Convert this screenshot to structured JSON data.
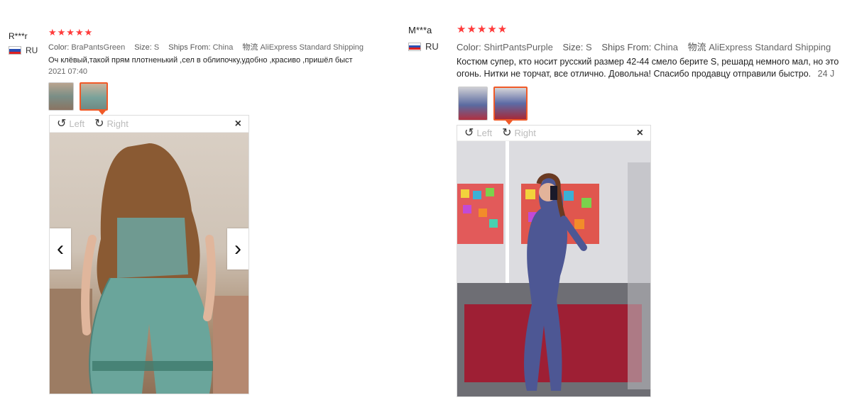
{
  "reviews": [
    {
      "user": "R***r",
      "country": "RU",
      "stars": "★★★★★",
      "color_label": "Color:",
      "color_value": "BraPantsGreen",
      "size_label": "Size:",
      "size_value": "S",
      "ships_label": "Ships From:",
      "ships_value": "China",
      "shipping_label": "物流",
      "shipping_value": "AliExpress Standard Shipping",
      "text": "Оч клёвый,такой прям плотненький ,сел в облипочку,удобно ,красиво ,пришёл быст",
      "date": "2021 07:40",
      "viewer": {
        "left": "Left",
        "right": "Right",
        "close": "×"
      }
    },
    {
      "user": "M***a",
      "country": "RU",
      "stars": "★★★★★",
      "color_label": "Color:",
      "color_value": "ShirtPantsPurple",
      "size_label": "Size:",
      "size_value": "S",
      "ships_label": "Ships From:",
      "ships_value": "China",
      "shipping_label": "物流",
      "shipping_value": "AliExpress Standard Shipping",
      "text_line1": "Костюм супер, кто носит русский размер 42-44 смело берите S, решард немного мал, но это",
      "text_line2": "огонь. Нитки не торчат, все отлично. Довольна! Спасибо продавцу отправили быстро.",
      "date": "24 J",
      "viewer": {
        "left": "Left",
        "right": "Right",
        "close": "×"
      }
    }
  ],
  "icons": {
    "prev": "‹",
    "next": "›",
    "rotate_left": "↺",
    "rotate_right": "↻"
  },
  "colors": {
    "star": "#ff3b3b",
    "accent": "#f05a28"
  }
}
